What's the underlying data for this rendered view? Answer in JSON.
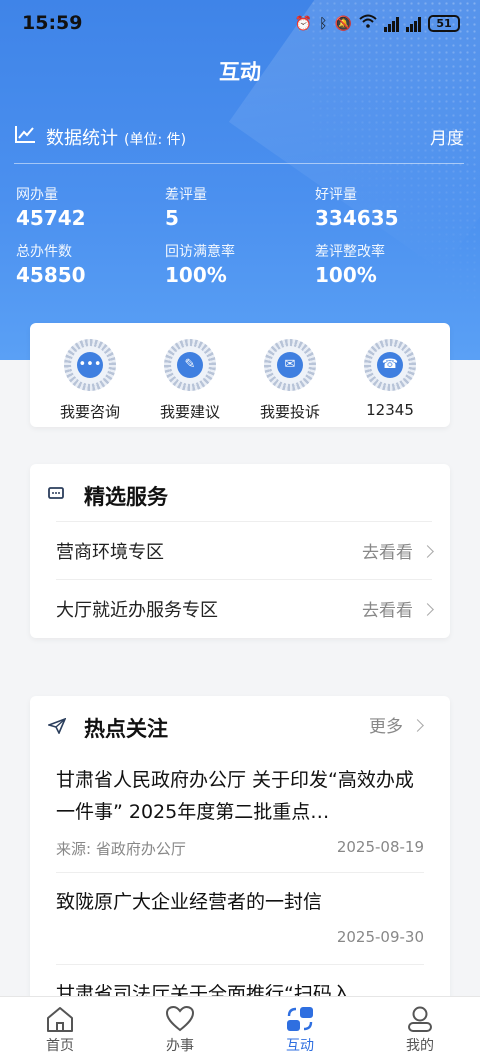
{
  "status_bar": {
    "time": "15:59",
    "battery": "51"
  },
  "page_title": "互动",
  "stats": {
    "title": "数据统计",
    "unit": "(单位: 件)",
    "period": "月度",
    "items": [
      {
        "label": "网办量",
        "value": "45742"
      },
      {
        "label": "差评量",
        "value": "5"
      },
      {
        "label": "好评量",
        "value": "334635"
      },
      {
        "label": "总办件数",
        "value": "45850"
      },
      {
        "label": "回访满意率",
        "value": "100%"
      },
      {
        "label": "差评整改率",
        "value": "100%"
      }
    ]
  },
  "quick_actions": [
    {
      "label": "我要咨询",
      "icon": "chat-bubble-icon"
    },
    {
      "label": "我要建议",
      "icon": "pencil-icon"
    },
    {
      "label": "我要投诉",
      "icon": "message-icon"
    },
    {
      "label": "12345",
      "icon": "hotline-icon"
    }
  ],
  "services": {
    "title": "精选服务",
    "items": [
      {
        "label": "营商环境专区",
        "action": "去看看"
      },
      {
        "label": "大厅就近办服务专区",
        "action": "去看看"
      }
    ]
  },
  "hot": {
    "title": "热点关注",
    "more": "更多",
    "items": [
      {
        "title": "甘肃省人民政府办公厅 关于印发“高效办成一件事” 2025年度第二批重点…",
        "source": "来源: 省政府办公厅",
        "date": "2025-08-19"
      },
      {
        "title": "致陇原广大企业经营者的一封信",
        "source": "",
        "date": "2025-09-30"
      },
      {
        "title": "甘肃省司法厅关于全面推行“扫码入",
        "source": "",
        "date": ""
      }
    ]
  },
  "tabs": [
    {
      "label": "首页",
      "icon": "home-icon"
    },
    {
      "label": "办事",
      "icon": "heart-icon"
    },
    {
      "label": "互动",
      "icon": "interaction-icon"
    },
    {
      "label": "我的",
      "icon": "user-icon"
    }
  ],
  "colors": {
    "primary": "#3f84e8",
    "active_tab": "#2f6fe0"
  }
}
